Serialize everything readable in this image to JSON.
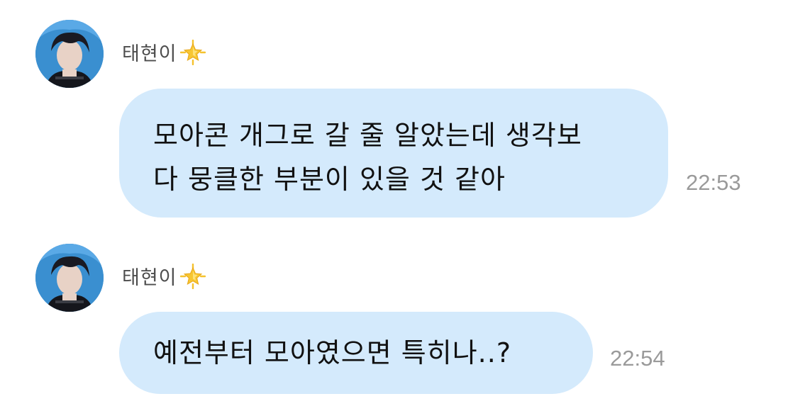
{
  "messages": [
    {
      "sender": "태현이",
      "text": "모아콘 개그로 갈 줄 알았는데 생각보다 뭉클한 부분이 있을 것 같아",
      "line1": "모아콘 개그로 갈 줄 알았는데 생각보",
      "line2": "다 뭉클한 부분이 있을 것 같아",
      "time": "22:53"
    },
    {
      "sender": "태현이",
      "text": "예전부터 모아였으면 특히나..?",
      "line1": "예전부터 모아였으면 특히나..?",
      "time": "22:54"
    }
  ],
  "colors": {
    "bubble": "#d4eafc",
    "text": "#111111",
    "timestamp": "#9a9a9a",
    "sender": "#4d4d4d",
    "avatar_bg": "#3a8fd0"
  },
  "icons": {
    "sender_badge": "glowing-star-icon",
    "avatar": "profile-photo"
  }
}
